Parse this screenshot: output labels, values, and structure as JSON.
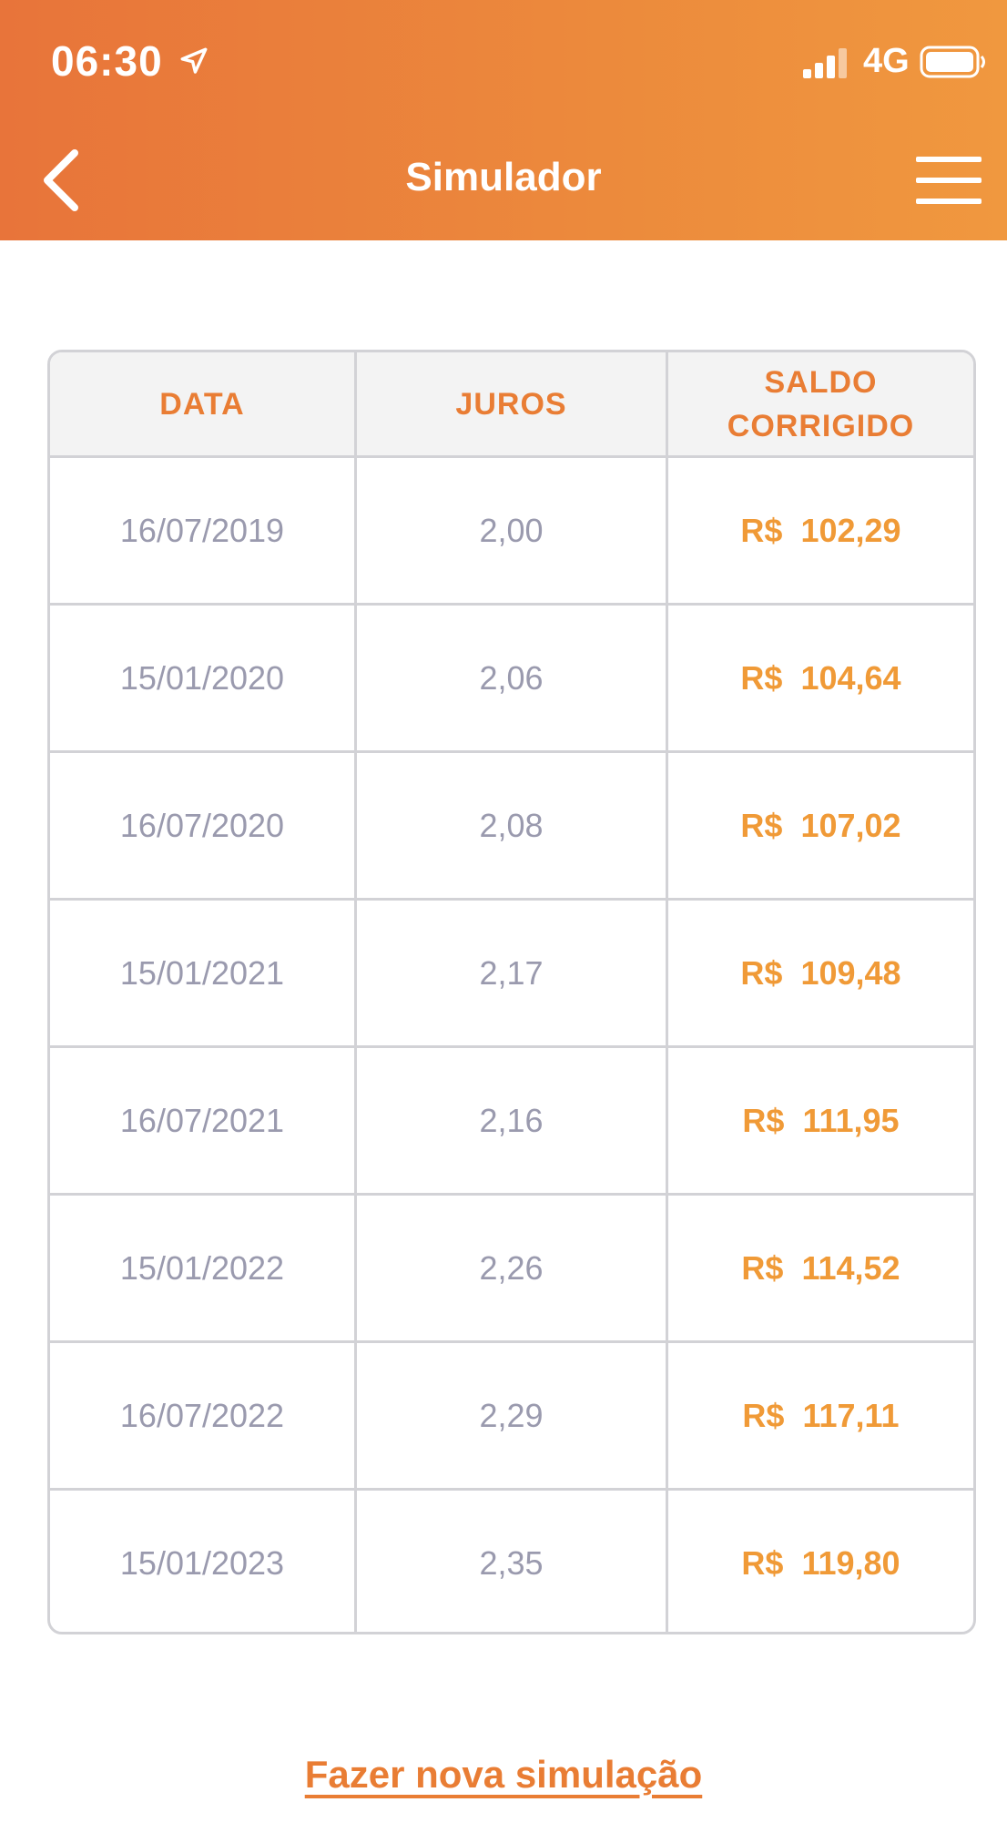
{
  "status_bar": {
    "time": "06:30",
    "network": "4G"
  },
  "header": {
    "title": "Simulador"
  },
  "table": {
    "columns": [
      "DATA",
      "JUROS",
      "SALDO\nCORRIGIDO"
    ],
    "rows": [
      {
        "date": "16/07/2019",
        "interest": "2,00",
        "currency": "R$",
        "balance": "102,29"
      },
      {
        "date": "15/01/2020",
        "interest": "2,06",
        "currency": "R$",
        "balance": "104,64"
      },
      {
        "date": "16/07/2020",
        "interest": "2,08",
        "currency": "R$",
        "balance": "107,02"
      },
      {
        "date": "15/01/2021",
        "interest": "2,17",
        "currency": "R$",
        "balance": "109,48"
      },
      {
        "date": "16/07/2021",
        "interest": "2,16",
        "currency": "R$",
        "balance": "111,95"
      },
      {
        "date": "15/01/2022",
        "interest": "2,26",
        "currency": "R$",
        "balance": "114,52"
      },
      {
        "date": "16/07/2022",
        "interest": "2,29",
        "currency": "R$",
        "balance": "117,11"
      },
      {
        "date": "15/01/2023",
        "interest": "2,35",
        "currency": "R$",
        "balance": "119,80"
      }
    ]
  },
  "actions": {
    "new_simulation": "Fazer nova simulação"
  },
  "colors": {
    "header_start": "#e8743a",
    "header_end": "#f0983f",
    "accent": "#e97d34",
    "money": "#f09a37",
    "muted_text": "#9a9aae"
  },
  "icons": {
    "back": "chevron-left-icon",
    "menu": "hamburger-menu-icon",
    "location": "location-arrow-icon",
    "signal": "signal-bars-icon",
    "battery": "battery-icon"
  }
}
